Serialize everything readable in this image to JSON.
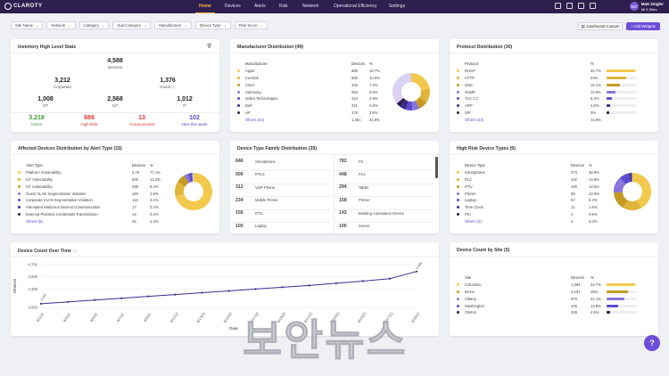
{
  "brand": "CLAROTY",
  "nav": [
    "Home",
    "Devices",
    "Alerts",
    "Risk",
    "Network",
    "Operational Efficiency",
    "Settings"
  ],
  "user": {
    "initials": "MZ",
    "name": "Matt Zeigler",
    "scope": "All 5 Sites"
  },
  "filters": [
    "Site Name",
    "Network",
    "Category",
    "Sub-Category",
    "Manufacturer",
    "Device Type",
    "Risk Score"
  ],
  "dashboard_btn": "Dashboard Custom",
  "add_btn": "+ Add Widgets",
  "inventory": {
    "title": "Inventory High Level Stats",
    "total": "4,588",
    "total_label": "Devices",
    "corporate": "3,212",
    "corporate_label": "Corporate",
    "guest": "1,376",
    "guest_label": "Guest",
    "ot": "1,008",
    "ot_label": "OT",
    "iot": "2,568",
    "iot_label": "IoT",
    "it": "1,012",
    "it_label": "IT",
    "online": "3,218",
    "online_label": "Online",
    "highrisk": "689",
    "highrisk_label": "High Risk",
    "compromised": "13",
    "compromised_label": "Compromised",
    "newweek": "102",
    "newweek_label": "New this week"
  },
  "manufacturer": {
    "title": "Manufacturer Distribution (49)",
    "h": [
      "Manufacturer",
      "Devices",
      "%"
    ],
    "rows": [
      [
        "Apple",
        "905",
        "19.7%",
        "#f2c94c"
      ],
      [
        "Centrak",
        "500",
        "10.9%",
        "#e0b43a"
      ],
      [
        "Cisco",
        "332",
        "7.2%",
        "#c49a22"
      ],
      [
        "Samsung",
        "254",
        "5.5%",
        "#8a76d9"
      ],
      [
        "Zebra Technologies",
        "224",
        "4.9%",
        "#5b4bd0"
      ],
      [
        "Dell",
        "221",
        "4.8%",
        "#3d2c8d"
      ],
      [
        "HP",
        "176",
        "3.8%",
        "#2d1f4e"
      ]
    ],
    "others": "Others (42)",
    "others_n": "1,451",
    "others_p": "31.6%"
  },
  "protocol": {
    "title": "Protocol Distribution (30)",
    "h": [
      "Protocol",
      "%"
    ],
    "rows": [
      [
        "DHCP",
        "34.7%",
        0.95,
        "#f2c94c"
      ],
      [
        "HTTP",
        "24%",
        0.66,
        "#e0b43a"
      ],
      [
        "DNS",
        "16.1%",
        0.44,
        "#c49a22"
      ],
      [
        "SNMP",
        "10.9%",
        0.3,
        "#8a76d9"
      ],
      [
        "TLS 1.2",
        "6.3%",
        0.17,
        "#5b4bd0"
      ],
      [
        "ARP",
        "4.8%",
        0.13,
        "#3d2c8d"
      ],
      [
        "SIP",
        "3%",
        0.08,
        "#2d1f4e"
      ]
    ],
    "others": "Others (23)",
    "others_p": "12.8%"
  },
  "alerts": {
    "title": "Affected Devices Distribution by Alert Type (15)",
    "h": [
      "Alert Type",
      "Devices",
      "%"
    ],
    "rows": [
      [
        "Platform Vulnerability",
        "2.7K",
        "77.1%",
        "#f2c94c"
      ],
      [
        "IoT Vulnerability",
        "500",
        "13.4%",
        "#e0b43a"
      ],
      [
        "OT Vulnerability",
        "296",
        "8.4%",
        "#c49a22"
      ],
      [
        "Guest VLAN Segmentation Violation",
        "150",
        "3.9%",
        "#8a76d9"
      ],
      [
        "Corporate VLAN Segmentation Violation",
        "118",
        "3.1%",
        "#5b4bd0"
      ],
      [
        "Attempted Malicious Internet Communication",
        "17",
        "0.4%",
        "#3d2c8d"
      ],
      [
        "External Plaintext Credentials Transmission",
        "14",
        "0.4%",
        "#2d1f4e"
      ]
    ],
    "others": "Others (8)",
    "others_n": "48",
    "others_p": "1.3%"
  },
  "family": {
    "title": "Device Type Family Distribution (39)",
    "cells": [
      [
        "846",
        "Smartphone"
      ],
      [
        "782",
        "PC"
      ],
      [
        "500",
        "RTLS"
      ],
      [
        "448",
        "PLC"
      ],
      [
        "312",
        "VoIP Phone"
      ],
      [
        "294",
        "Tablet"
      ],
      [
        "234",
        "Mobile Printer"
      ],
      [
        "158",
        "Printer"
      ],
      [
        "156",
        "RTU"
      ],
      [
        "143",
        "Building Automation Device"
      ],
      [
        "100",
        "Laptop"
      ],
      [
        "100",
        "Server"
      ]
    ]
  },
  "highrisk": {
    "title": "High Risk Device Types (9)",
    "h": [
      "Device Type",
      "Devices",
      "%"
    ],
    "rows": [
      [
        "Smartphone",
        "273",
        "38.6%",
        "#f2c94c"
      ],
      [
        "PLC",
        "102",
        "14.8%",
        "#e0b43a"
      ],
      [
        "RTU",
        "100",
        "14.5%",
        "#c49a22"
      ],
      [
        "Printer",
        "89",
        "12.9%",
        "#8a76d9"
      ],
      [
        "Laptop",
        "57",
        "8.3%",
        "#5b4bd0"
      ],
      [
        "Time Clock",
        "11",
        "1.6%",
        "#3d2c8d"
      ],
      [
        "PIC",
        "4",
        "0.6%",
        "#2d1f4e"
      ]
    ],
    "others": "Others (2)",
    "others_n": "3",
    "others_p": "0.4%"
  },
  "overtime": {
    "title": "Device Count Over Time",
    "ylabel": "Devices",
    "xlabel": "Date"
  },
  "bysite": {
    "title": "Device Count by Site (5)",
    "h": [
      "Site",
      "Devices",
      "%"
    ],
    "rows": [
      [
        "Columbia",
        "1,594",
        "34.7%",
        0.95,
        "#f2c94c"
      ],
      [
        "Bronx",
        "1,191",
        "26%",
        0.71,
        "#c49a22"
      ],
      [
        "Albany",
        "970",
        "21.1%",
        0.58,
        "#8a76d9"
      ],
      [
        "Washington",
        "425",
        "13.6%",
        0.37,
        "#5b4bd0"
      ],
      [
        "Clinton",
        "208",
        "4.5%",
        0.12,
        "#2d1f4e"
      ]
    ]
  },
  "watermark": "보안뉴스",
  "help": "?",
  "chart_data": {
    "type": "line",
    "title": "Device Count Over Time",
    "xlabel": "Date",
    "ylabel": "Devices",
    "ylim": [
      4000,
      4700
    ],
    "yticks": [
      "4,700",
      "4,500",
      "4,300",
      "4,000"
    ],
    "x": [
      "6/1/22",
      "6/3/22",
      "6/5/22",
      "6/7/22",
      "6/9/22",
      "6/11/22",
      "6/13/22",
      "6/15/22",
      "6/17/22",
      "6/19/22",
      "6/21/22",
      "6/23/22",
      "6/25/22",
      "6/27/22",
      "6/29/22"
    ],
    "series": [
      {
        "values": [
          4060,
          4090,
          4120,
          4150,
          4180,
          4210,
          4240,
          4270,
          4300,
          4330,
          4360,
          4395,
          4430,
          4470,
          4588
        ]
      }
    ],
    "first_label": "4,060",
    "last_label": "4,588"
  }
}
